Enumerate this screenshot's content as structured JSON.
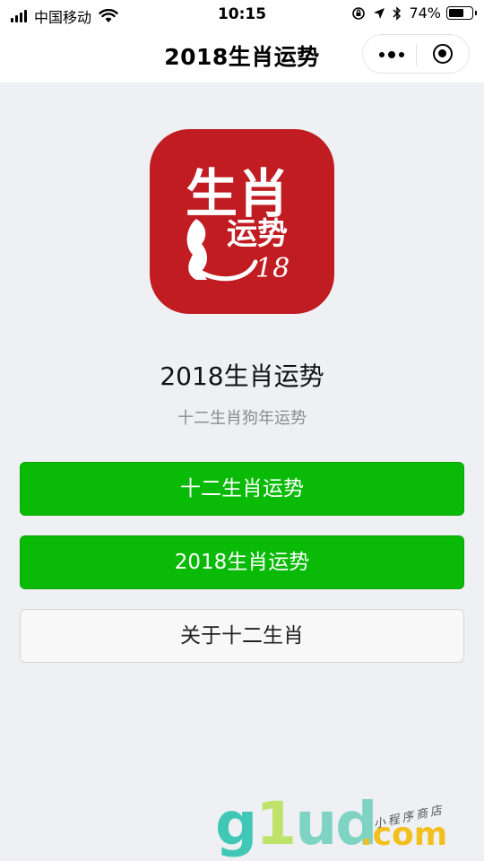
{
  "status_bar": {
    "carrier": "中国移动",
    "time": "10:15",
    "battery_percent": "74%",
    "battery_level": 0.74
  },
  "nav": {
    "title": "2018生肖运势"
  },
  "app": {
    "logo_text_top": "生肖",
    "logo_text_mid": "运势",
    "logo_text_num": "18",
    "title": "2018生肖运势",
    "subtitle": "十二生肖狗年运势"
  },
  "buttons": {
    "zodiac_fortune": "十二生肖运势",
    "fortune_2018": "2018生肖运势",
    "about": "关于十二生肖"
  },
  "watermark": {
    "brand_g": "g",
    "brand_1": "1",
    "brand_ud": "ud",
    "domain": ".com",
    "tagline": "小程序商店"
  },
  "colors": {
    "primary_green": "#09bb07",
    "logo_red": "#c01c22",
    "background": "#eff0f4"
  }
}
